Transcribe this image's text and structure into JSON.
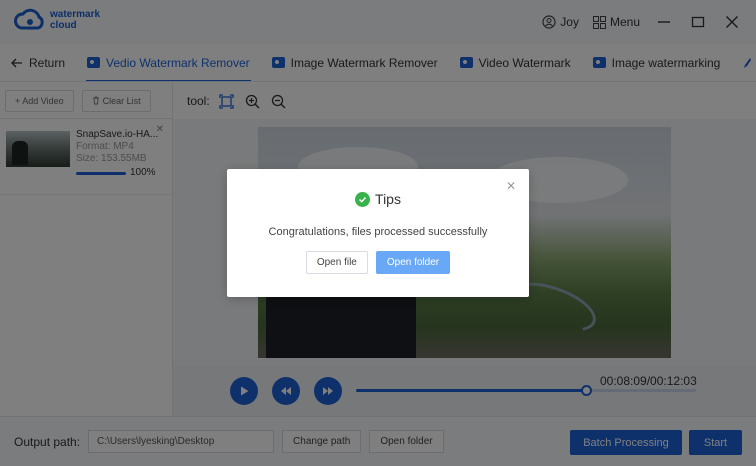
{
  "app": {
    "logo_line1": "watermark",
    "logo_line2": "cloud",
    "user_label": "Joy",
    "menu_label": "Menu",
    "accent_color": "#1d63d8"
  },
  "nav": {
    "return_label": "Return",
    "tabs": [
      {
        "label": "Vedio Watermark Remover",
        "icon": "video-remove-icon",
        "active": true
      },
      {
        "label": "Image Watermark Remover",
        "icon": "image-remove-icon",
        "active": false
      },
      {
        "label": "Video Watermark",
        "icon": "video-watermark-icon",
        "active": false
      },
      {
        "label": "Image watermarking",
        "icon": "image-watermark-icon",
        "active": false
      }
    ]
  },
  "file_panel": {
    "add_video_label": "+ Add Video",
    "clear_list_label": "Clear List",
    "files": [
      {
        "name": "SnapSave.io-HA...",
        "format": "Format:  MP4",
        "size": "Size:  153.55MB",
        "progress_label": "100%",
        "progress": 1.0
      }
    ]
  },
  "preview": {
    "tool_label": "tool:",
    "time_label": "00:08:09/00:12:03",
    "playback_fraction": 0.676
  },
  "bottom": {
    "output_label": "Output path:",
    "output_path": "C:\\Users\\lyesking\\Desktop",
    "change_path_label": "Change path",
    "open_folder_label": "Open folder",
    "batch_label": "Batch Processing",
    "start_label": "Start"
  },
  "dialog": {
    "title": "Tips",
    "message": "Congratulations, files processed successfully",
    "open_file_label": "Open file",
    "open_folder_label": "Open folder",
    "success_color": "#38b24a"
  }
}
